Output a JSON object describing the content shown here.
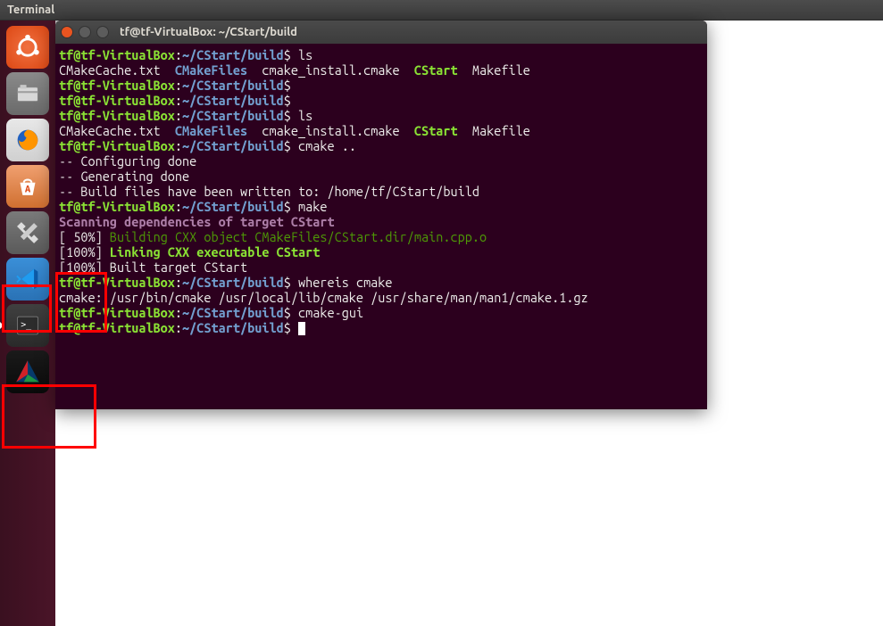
{
  "top_panel": {
    "active_app": "Terminal"
  },
  "launcher": {
    "items": [
      {
        "name": "ubuntu-dash",
        "label": "Dash"
      },
      {
        "name": "files",
        "label": "Files"
      },
      {
        "name": "firefox",
        "label": "Firefox"
      },
      {
        "name": "software",
        "label": "Ubuntu Software"
      },
      {
        "name": "settings",
        "label": "System Settings"
      },
      {
        "name": "vscode",
        "label": "Visual Studio Code"
      },
      {
        "name": "terminal",
        "label": "Terminal"
      },
      {
        "name": "cmake-gui",
        "label": "CMake"
      }
    ]
  },
  "terminal": {
    "title": "tf@tf-VirtualBox: ~/CStart/build",
    "prompt_user": "tf@tf-VirtualBox",
    "prompt_sep": ":",
    "prompt_path": "~/CStart/build",
    "prompt_sym": "$",
    "lines": {
      "cmd_ls1": "ls",
      "ls_out": {
        "f1": "CMakeCache.txt",
        "f2": "CMakeFiles",
        "f3": "cmake_install.cmake",
        "f4": "CStart",
        "f5": "Makefile"
      },
      "cmd_ls2": "ls",
      "cmd_cmake": "cmake ..",
      "cfg1": "-- Configuring done",
      "cfg2": "-- Generating done",
      "cfg3": "-- Build files have been written to: /home/tf/CStart/build",
      "cmd_make": "make",
      "scan": "Scanning dependencies of target CStart",
      "pct50": "[ 50%]",
      "build_cxx": "Building CXX object CMakeFiles/CStart.dir/main.cpp.o",
      "pct100": "[100%]",
      "link_cxx": "Linking CXX executable CStart",
      "built": "Built target CStart",
      "cmd_whereis": "whereis cmake",
      "whereis_out": "cmake: /usr/bin/cmake /usr/local/lib/cmake /usr/share/man/man1/cmake.1.gz",
      "cmd_cmakegui": "cmake-gui"
    }
  },
  "annotations": {
    "red_box_vscode": true,
    "red_box_cmake": true,
    "red_box_whereis": true
  }
}
